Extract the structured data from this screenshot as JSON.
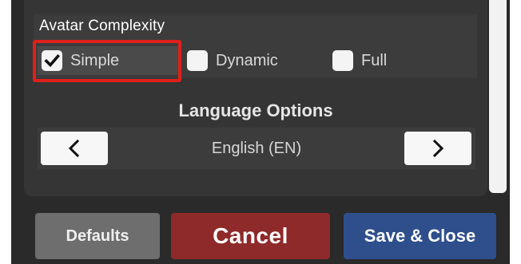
{
  "avatar_complexity": {
    "title": "Avatar Complexity",
    "options": [
      {
        "label": "Simple",
        "checked": true
      },
      {
        "label": "Dynamic",
        "checked": false
      },
      {
        "label": "Full",
        "checked": false
      }
    ]
  },
  "language": {
    "title": "Language Options",
    "value": "English (EN)",
    "prev_icon": "chevron-left",
    "next_icon": "chevron-right"
  },
  "buttons": {
    "defaults": "Defaults",
    "cancel": "Cancel",
    "save_close": "Save & Close"
  },
  "colors": {
    "highlight": "#e0201b",
    "cancel": "#8e2a2a",
    "save": "#2e4f8c",
    "defaults": "#6e6e6e"
  }
}
